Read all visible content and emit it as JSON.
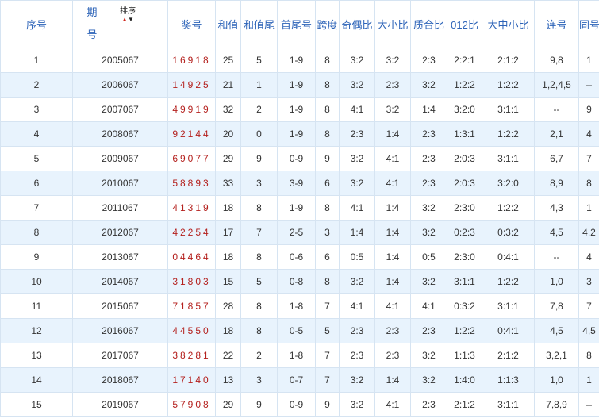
{
  "colors": {
    "header_text": "#2c63b8",
    "number_red": "#b4201d",
    "row_alt": "#e8f3fd",
    "border": "#d6e4f2"
  },
  "headers": {
    "xuhao": "序号",
    "qihao_1": "期",
    "qihao_2": "号",
    "sort_label": "排序",
    "jianghao": "奖号",
    "hezhi": "和值",
    "hezhiwei": "和值尾",
    "shouweihao": "首尾号",
    "kuadu": "跨度",
    "jiou": "奇偶比",
    "daxiao": "大小比",
    "zhihe": "质合比",
    "lingyier": "012比",
    "dazhongxiao": "大中小比",
    "lianhao": "连号",
    "tonghao": "同号"
  },
  "rows": [
    {
      "seq": "1",
      "period": "2005067",
      "number": "16918",
      "sum": "25",
      "sum_tail": "5",
      "first_last": "1-9",
      "span": "8",
      "odd_even": "3:2",
      "big_small": "3:2",
      "prime_comp": "2:3",
      "r012": "2:2:1",
      "bms": "2:1:2",
      "consec": "9,8",
      "same": "1"
    },
    {
      "seq": "2",
      "period": "2006067",
      "number": "14925",
      "sum": "21",
      "sum_tail": "1",
      "first_last": "1-9",
      "span": "8",
      "odd_even": "3:2",
      "big_small": "2:3",
      "prime_comp": "3:2",
      "r012": "1:2:2",
      "bms": "1:2:2",
      "consec": "1,2,4,5",
      "same": "--"
    },
    {
      "seq": "3",
      "period": "2007067",
      "number": "49919",
      "sum": "32",
      "sum_tail": "2",
      "first_last": "1-9",
      "span": "8",
      "odd_even": "4:1",
      "big_small": "3:2",
      "prime_comp": "1:4",
      "r012": "3:2:0",
      "bms": "3:1:1",
      "consec": "--",
      "same": "9"
    },
    {
      "seq": "4",
      "period": "2008067",
      "number": "92144",
      "sum": "20",
      "sum_tail": "0",
      "first_last": "1-9",
      "span": "8",
      "odd_even": "2:3",
      "big_small": "1:4",
      "prime_comp": "2:3",
      "r012": "1:3:1",
      "bms": "1:2:2",
      "consec": "2,1",
      "same": "4"
    },
    {
      "seq": "5",
      "period": "2009067",
      "number": "69077",
      "sum": "29",
      "sum_tail": "9",
      "first_last": "0-9",
      "span": "9",
      "odd_even": "3:2",
      "big_small": "4:1",
      "prime_comp": "2:3",
      "r012": "2:0:3",
      "bms": "3:1:1",
      "consec": "6,7",
      "same": "7"
    },
    {
      "seq": "6",
      "period": "2010067",
      "number": "58893",
      "sum": "33",
      "sum_tail": "3",
      "first_last": "3-9",
      "span": "6",
      "odd_even": "3:2",
      "big_small": "4:1",
      "prime_comp": "2:3",
      "r012": "2:0:3",
      "bms": "3:2:0",
      "consec": "8,9",
      "same": "8"
    },
    {
      "seq": "7",
      "period": "2011067",
      "number": "41319",
      "sum": "18",
      "sum_tail": "8",
      "first_last": "1-9",
      "span": "8",
      "odd_even": "4:1",
      "big_small": "1:4",
      "prime_comp": "3:2",
      "r012": "2:3:0",
      "bms": "1:2:2",
      "consec": "4,3",
      "same": "1"
    },
    {
      "seq": "8",
      "period": "2012067",
      "number": "42254",
      "sum": "17",
      "sum_tail": "7",
      "first_last": "2-5",
      "span": "3",
      "odd_even": "1:4",
      "big_small": "1:4",
      "prime_comp": "3:2",
      "r012": "0:2:3",
      "bms": "0:3:2",
      "consec": "4,5",
      "same": "4,2"
    },
    {
      "seq": "9",
      "period": "2013067",
      "number": "04464",
      "sum": "18",
      "sum_tail": "8",
      "first_last": "0-6",
      "span": "6",
      "odd_even": "0:5",
      "big_small": "1:4",
      "prime_comp": "0:5",
      "r012": "2:3:0",
      "bms": "0:4:1",
      "consec": "--",
      "same": "4"
    },
    {
      "seq": "10",
      "period": "2014067",
      "number": "31803",
      "sum": "15",
      "sum_tail": "5",
      "first_last": "0-8",
      "span": "8",
      "odd_even": "3:2",
      "big_small": "1:4",
      "prime_comp": "3:2",
      "r012": "3:1:1",
      "bms": "1:2:2",
      "consec": "1,0",
      "same": "3"
    },
    {
      "seq": "11",
      "period": "2015067",
      "number": "71857",
      "sum": "28",
      "sum_tail": "8",
      "first_last": "1-8",
      "span": "7",
      "odd_even": "4:1",
      "big_small": "4:1",
      "prime_comp": "4:1",
      "r012": "0:3:2",
      "bms": "3:1:1",
      "consec": "7,8",
      "same": "7"
    },
    {
      "seq": "12",
      "period": "2016067",
      "number": "44550",
      "sum": "18",
      "sum_tail": "8",
      "first_last": "0-5",
      "span": "5",
      "odd_even": "2:3",
      "big_small": "2:3",
      "prime_comp": "2:3",
      "r012": "1:2:2",
      "bms": "0:4:1",
      "consec": "4,5",
      "same": "4,5"
    },
    {
      "seq": "13",
      "period": "2017067",
      "number": "38281",
      "sum": "22",
      "sum_tail": "2",
      "first_last": "1-8",
      "span": "7",
      "odd_even": "2:3",
      "big_small": "2:3",
      "prime_comp": "3:2",
      "r012": "1:1:3",
      "bms": "2:1:2",
      "consec": "3,2,1",
      "same": "8"
    },
    {
      "seq": "14",
      "period": "2018067",
      "number": "17140",
      "sum": "13",
      "sum_tail": "3",
      "first_last": "0-7",
      "span": "7",
      "odd_even": "3:2",
      "big_small": "1:4",
      "prime_comp": "3:2",
      "r012": "1:4:0",
      "bms": "1:1:3",
      "consec": "1,0",
      "same": "1"
    },
    {
      "seq": "15",
      "period": "2019067",
      "number": "57908",
      "sum": "29",
      "sum_tail": "9",
      "first_last": "0-9",
      "span": "9",
      "odd_even": "3:2",
      "big_small": "4:1",
      "prime_comp": "2:3",
      "r012": "2:1:2",
      "bms": "3:1:1",
      "consec": "7,8,9",
      "same": "--"
    }
  ]
}
